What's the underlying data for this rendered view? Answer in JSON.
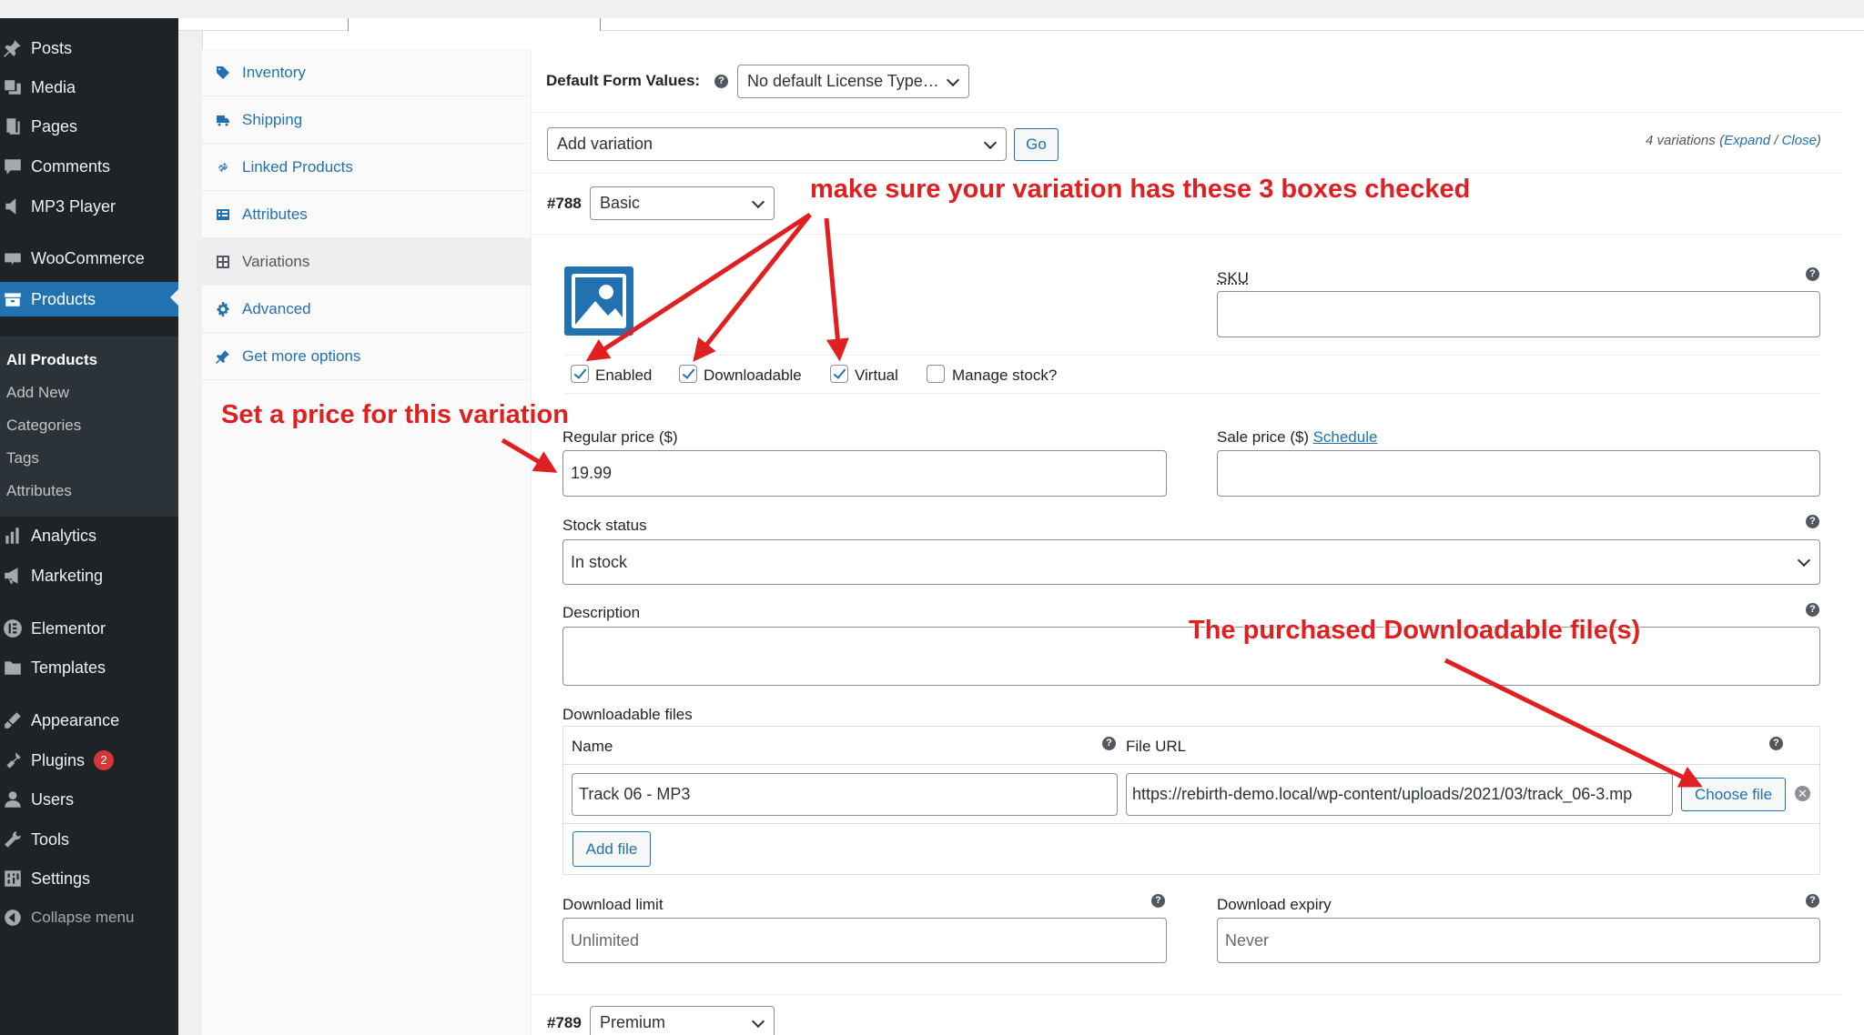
{
  "admin_menu": {
    "items": [
      {
        "label": "Posts",
        "icon": "pushpin-icon"
      },
      {
        "label": "Media",
        "icon": "media-icon"
      },
      {
        "label": "Pages",
        "icon": "pages-icon"
      },
      {
        "label": "Comments",
        "icon": "comment-icon"
      },
      {
        "label": "MP3 Player",
        "icon": "player-icon"
      },
      {
        "label": "WooCommerce",
        "icon": "woo-icon"
      },
      {
        "label": "Products",
        "icon": "archive-icon"
      },
      {
        "label": "Analytics",
        "icon": "bar-chart-icon"
      },
      {
        "label": "Marketing",
        "icon": "megaphone-icon"
      },
      {
        "label": "Elementor",
        "icon": "elementor-icon"
      },
      {
        "label": "Templates",
        "icon": "folder-icon"
      },
      {
        "label": "Appearance",
        "icon": "brush-icon"
      },
      {
        "label": "Plugins",
        "icon": "plug-icon",
        "badge": "2"
      },
      {
        "label": "Users",
        "icon": "user-icon"
      },
      {
        "label": "Tools",
        "icon": "wrench-icon"
      },
      {
        "label": "Settings",
        "icon": "sliders-icon"
      }
    ],
    "products_submenu": [
      "All Products",
      "Add New",
      "Categories",
      "Tags",
      "Attributes"
    ],
    "collapse_label": "Collapse menu"
  },
  "product_tabs": [
    {
      "label": "Inventory",
      "icon": "tag-icon"
    },
    {
      "label": "Shipping",
      "icon": "truck-icon"
    },
    {
      "label": "Linked Products",
      "icon": "link-icon"
    },
    {
      "label": "Attributes",
      "icon": "list-icon"
    },
    {
      "label": "Variations",
      "icon": "grid-icon"
    },
    {
      "label": "Advanced",
      "icon": "gear-icon"
    },
    {
      "label": "Get more options",
      "icon": "plugin-icon"
    }
  ],
  "variations": {
    "default_form_label": "Default Form Values:",
    "default_license_select": "No default License Type…",
    "add_variation_select": "Add variation",
    "go_label": "Go",
    "count_text": "4 variations",
    "expand_label": "Expand",
    "close_label": "Close",
    "variation_1": {
      "id": "#788",
      "type": "Basic",
      "sku_label": "SKU",
      "sku_value": "",
      "enabled_label": "Enabled",
      "downloadable_label": "Downloadable",
      "virtual_label": "Virtual",
      "manage_stock_label": "Manage stock?",
      "regular_price_label": "Regular price ($)",
      "regular_price_value": "19.99",
      "sale_price_label": "Sale price ($)",
      "schedule_label": "Schedule",
      "sale_price_value": "",
      "stock_status_label": "Stock status",
      "stock_status_value": "In stock",
      "description_label": "Description",
      "downloadable_files_label": "Downloadable files",
      "name_header": "Name",
      "file_url_header": "File URL",
      "file_name_value": "Track 06 - MP3",
      "file_url_value": "https://rebirth-demo.local/wp-content/uploads/2021/03/track_06-3.mp",
      "choose_file_label": "Choose file",
      "add_file_label": "Add file",
      "download_limit_label": "Download limit",
      "download_limit_placeholder": "Unlimited",
      "download_expiry_label": "Download expiry",
      "download_expiry_placeholder": "Never"
    },
    "variation_2": {
      "id": "#789",
      "type": "Premium"
    }
  },
  "annotations": {
    "checkboxes_note": "make sure your variation has these 3 boxes checked",
    "price_note": "Set a price for this variation",
    "file_note": "The purchased Downloadable file(s)",
    "color": "#e02020"
  }
}
